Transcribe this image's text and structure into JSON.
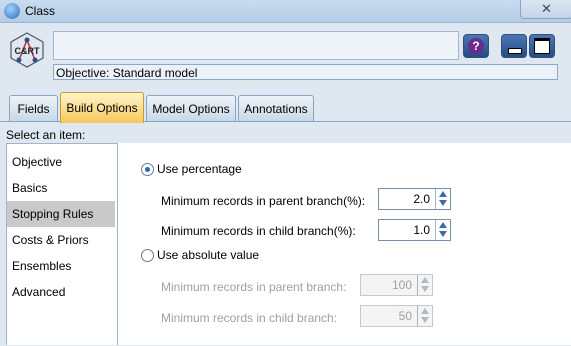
{
  "window": {
    "title": "Class",
    "close_symbol": "✕"
  },
  "header": {
    "model_icon_text": "C&RT",
    "name_value": "",
    "objective": "Objective: Standard model",
    "help_symbol": "?"
  },
  "tabs": [
    {
      "label": "Fields"
    },
    {
      "label": "Build Options"
    },
    {
      "label": "Model Options"
    },
    {
      "label": "Annotations"
    }
  ],
  "active_tab": "Build Options",
  "select_label": "Select an item:",
  "items": [
    {
      "label": "Objective"
    },
    {
      "label": "Basics"
    },
    {
      "label": "Stopping Rules"
    },
    {
      "label": "Costs & Priors"
    },
    {
      "label": "Ensembles"
    },
    {
      "label": "Advanced"
    }
  ],
  "selected_item": "Stopping Rules",
  "stopping": {
    "use_percentage": {
      "label": "Use percentage",
      "checked": true
    },
    "min_parent_pct": {
      "label": "Minimum records in parent branch(%):",
      "value": "2.0"
    },
    "min_child_pct": {
      "label": "Minimum records in child branch(%):",
      "value": "1.0"
    },
    "use_absolute": {
      "label": "Use absolute value",
      "checked": false
    },
    "min_parent_abs": {
      "label": "Minimum records in parent branch:",
      "value": "100",
      "disabled": true
    },
    "min_child_abs": {
      "label": "Minimum records in child branch:",
      "value": "50",
      "disabled": true
    }
  },
  "colors": {
    "active_tab": "#f6c75d",
    "selected_item": "#c9c9c9",
    "accent": "#2e64c4"
  }
}
